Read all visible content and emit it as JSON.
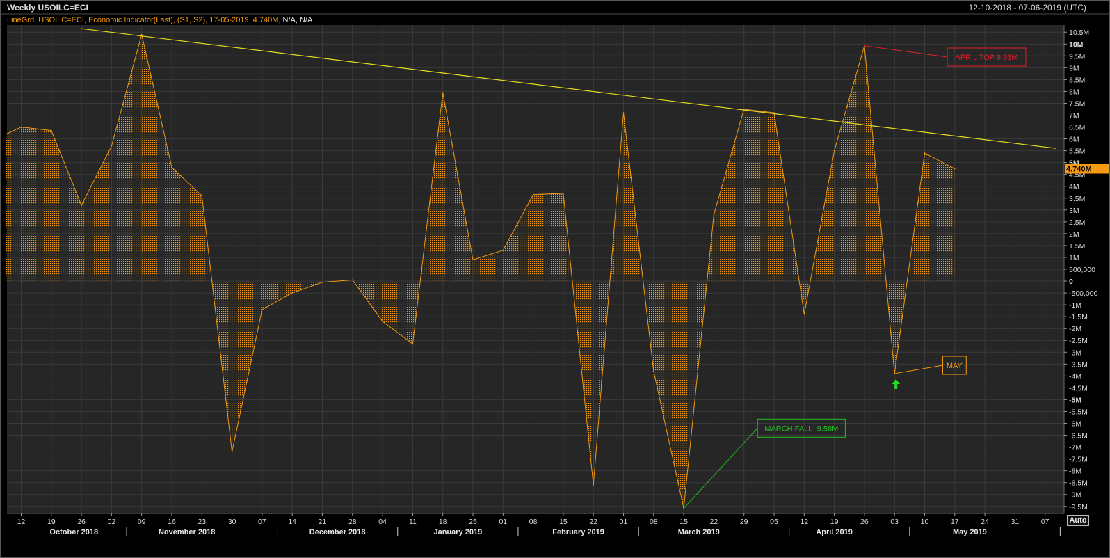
{
  "header": {
    "title": "Weekly USOILC=ECI",
    "date_range": "12-10-2018 - 07-06-2019 (UTC)",
    "legend_main": "LineGrd, USOILC=ECI, Economic Indicator(Last), (S1, S2), 17-05-2019, 4.740M,",
    "legend_na": "N/A, N/A"
  },
  "auto_button": "Auto",
  "last_value_badge": "4.740M",
  "colors": {
    "background": "#000000",
    "plot": "#262626",
    "grid": "#3a3a3a",
    "series": "#f39a10",
    "trendline": "#e6dd1b",
    "april_annotation": "#e0202a",
    "march_annotation": "#22c022",
    "may_annotation": "#f39a10",
    "arrow": "#22dd22"
  },
  "chart_data": {
    "type": "area",
    "title": "Weekly USOILC=ECI",
    "xlabel": "",
    "ylabel": "",
    "ylim": [
      -9.8,
      10.8
    ],
    "y_unit": "M",
    "grid": true,
    "x_ticks": [
      "12",
      "19",
      "26",
      "02",
      "09",
      "16",
      "23",
      "30",
      "07",
      "14",
      "21",
      "28",
      "04",
      "11",
      "18",
      "25",
      "01",
      "08",
      "15",
      "22",
      "01",
      "08",
      "15",
      "22",
      "29",
      "05",
      "12",
      "19",
      "26",
      "03",
      "10",
      "17",
      "24",
      "31",
      "07"
    ],
    "month_labels": [
      {
        "label": "October 2018",
        "week_index": 1.75
      },
      {
        "label": "November 2018",
        "week_index": 5.5
      },
      {
        "label": "December 2018",
        "week_index": 10.5
      },
      {
        "label": "January 2019",
        "week_index": 14.5
      },
      {
        "label": "February 2019",
        "week_index": 18.5
      },
      {
        "label": "March 2019",
        "week_index": 22.5
      },
      {
        "label": "April 2019",
        "week_index": 27
      },
      {
        "label": "May 2019",
        "week_index": 31.5
      }
    ],
    "month_separators": [
      3.5,
      8.5,
      12.5,
      16.5,
      20.5,
      25.5,
      29.5,
      34.5
    ],
    "y_ticks": [
      {
        "v": 10.5,
        "label": "10.5M"
      },
      {
        "v": 10,
        "label": "10M",
        "major": true
      },
      {
        "v": 9.5,
        "label": "9.5M"
      },
      {
        "v": 9,
        "label": "9M"
      },
      {
        "v": 8.5,
        "label": "8.5M"
      },
      {
        "v": 8,
        "label": "8M"
      },
      {
        "v": 7.5,
        "label": "7.5M"
      },
      {
        "v": 7,
        "label": "7M"
      },
      {
        "v": 6.5,
        "label": "6.5M"
      },
      {
        "v": 6,
        "label": "6M"
      },
      {
        "v": 5.5,
        "label": "5.5M"
      },
      {
        "v": 5,
        "label": "5M",
        "major": true
      },
      {
        "v": 4.5,
        "label": "4.5M"
      },
      {
        "v": 4,
        "label": "4M"
      },
      {
        "v": 3.5,
        "label": "3.5M"
      },
      {
        "v": 3,
        "label": "3M"
      },
      {
        "v": 2.5,
        "label": "2.5M"
      },
      {
        "v": 2,
        "label": "2M"
      },
      {
        "v": 1.5,
        "label": "1.5M"
      },
      {
        "v": 1,
        "label": "1M"
      },
      {
        "v": 0.5,
        "label": "500,000"
      },
      {
        "v": 0,
        "label": "0",
        "major": true
      },
      {
        "v": -0.5,
        "label": "-500,000"
      },
      {
        "v": -1,
        "label": "-1M"
      },
      {
        "v": -1.5,
        "label": "-1.5M"
      },
      {
        "v": -2,
        "label": "-2M"
      },
      {
        "v": -2.5,
        "label": "-2.5M"
      },
      {
        "v": -3,
        "label": "-3M"
      },
      {
        "v": -3.5,
        "label": "-3.5M"
      },
      {
        "v": -4,
        "label": "-4M"
      },
      {
        "v": -4.5,
        "label": "-4.5M"
      },
      {
        "v": -5,
        "label": "-5M",
        "major": true
      },
      {
        "v": -5.5,
        "label": "-5.5M"
      },
      {
        "v": -6,
        "label": "-6M"
      },
      {
        "v": -6.5,
        "label": "-6.5M"
      },
      {
        "v": -7,
        "label": "-7M"
      },
      {
        "v": -7.5,
        "label": "-7.5M"
      },
      {
        "v": -8,
        "label": "-8M"
      },
      {
        "v": -8.5,
        "label": "-8.5M"
      },
      {
        "v": -9,
        "label": "-9M"
      },
      {
        "v": -9.5,
        "label": "-9.5M"
      }
    ],
    "series": [
      {
        "values": [
          {
            "x": -0.5,
            "y": 6.2
          },
          {
            "x": 0,
            "y": 6.5
          },
          {
            "x": 1,
            "y": 6.35
          },
          {
            "x": 2,
            "y": 3.2
          },
          {
            "x": 3,
            "y": 5.7
          },
          {
            "x": 4,
            "y": 10.4
          },
          {
            "x": 5,
            "y": 4.8
          },
          {
            "x": 6,
            "y": 3.6
          },
          {
            "x": 7,
            "y": -7.2
          },
          {
            "x": 8,
            "y": -1.2
          },
          {
            "x": 9,
            "y": -0.5
          },
          {
            "x": 10,
            "y": -0.05
          },
          {
            "x": 11,
            "y": 0.05
          },
          {
            "x": 12,
            "y": -1.7
          },
          {
            "x": 13,
            "y": -2.65
          },
          {
            "x": 14,
            "y": 7.95
          },
          {
            "x": 15,
            "y": 0.9
          },
          {
            "x": 16,
            "y": 1.3
          },
          {
            "x": 17,
            "y": 3.65
          },
          {
            "x": 18,
            "y": 3.7
          },
          {
            "x": 19,
            "y": -8.6
          },
          {
            "x": 20,
            "y": 7.1
          },
          {
            "x": 21,
            "y": -3.8
          },
          {
            "x": 22,
            "y": -9.58
          },
          {
            "x": 23,
            "y": 2.8
          },
          {
            "x": 24,
            "y": 7.25
          },
          {
            "x": 25,
            "y": 7.1
          },
          {
            "x": 26,
            "y": -1.4
          },
          {
            "x": 27,
            "y": 5.5
          },
          {
            "x": 28,
            "y": 9.93
          },
          {
            "x": 29,
            "y": -3.9
          },
          {
            "x": 30,
            "y": 5.4
          },
          {
            "x": 31,
            "y": 4.74
          }
        ]
      }
    ],
    "trendline": {
      "x1": 2,
      "y1": 10.65,
      "x2": 34.35,
      "y2": 5.6
    },
    "annotations": [
      {
        "label": "APRIL TOP 9.93M",
        "x": 28,
        "y": 9.93,
        "box_x": 30.75,
        "box_y": 9.45,
        "color_key": "april_annotation"
      },
      {
        "label": "MARCH FALL -9.58M",
        "x": 22,
        "y": -9.58,
        "box_x": 24.45,
        "box_y": -6.2,
        "color_key": "march_annotation"
      },
      {
        "label": "MAY",
        "x": 29,
        "y": -3.9,
        "box_x": 30.6,
        "box_y": -3.55,
        "color_key": "may_annotation"
      }
    ]
  }
}
